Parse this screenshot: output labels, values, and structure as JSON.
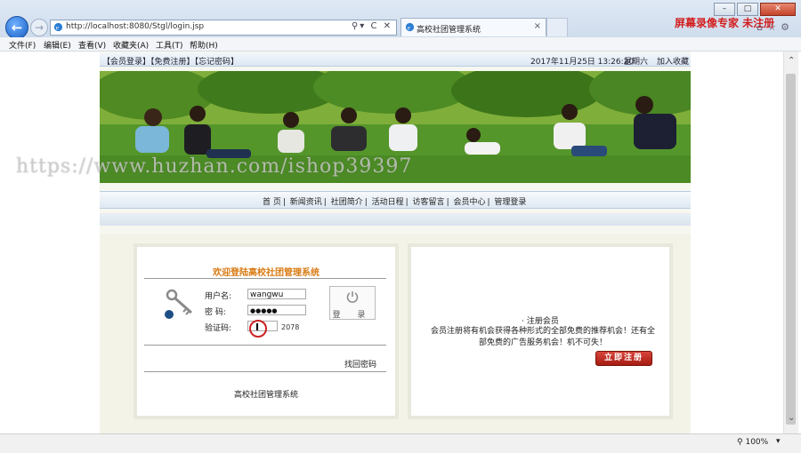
{
  "browser": {
    "url": "http://localhost:8080/Stgl/login.jsp",
    "tab_title": "高校社团管理系统",
    "recorder_text": "屏幕录像专家  未注册",
    "zoom": "100%",
    "menu": [
      "文件(F)",
      "编辑(E)",
      "查看(V)",
      "收藏夹(A)",
      "工具(T)",
      "帮助(H)"
    ]
  },
  "topbar": {
    "links": "【会员登录】【免费注册】【忘记密码】",
    "date": "2017年11月25日  13:26:20",
    "weekday": "星期六",
    "favorite": "加入收藏"
  },
  "nav": [
    "首  页",
    "新闻资讯",
    "社团简介",
    "活动日程",
    "访客留言",
    "会员中心",
    "管理登录"
  ],
  "login": {
    "welcome": "欢迎登陆高校社团管理系统",
    "username_label": "用户名:",
    "username_value": "wangwu",
    "password_label": "密  码:",
    "password_value": "●●●●●",
    "captcha_label": "验证码:",
    "captcha_value": "",
    "captcha_code": "2078",
    "login_button": "登  录",
    "forgot": "找回密码",
    "system_name": "高校社团管理系统"
  },
  "register": {
    "title": "· 注册会员",
    "description": "会员注册将有机会获得各种形式的全部免费的推荐机会！还有全部免费的广告服务机会！机不可失！",
    "button": "立即注册"
  },
  "watermark": "https://www.huzhan.com/ishop39397",
  "colors": {
    "accent": "#d87a12",
    "register_button": "#b8261a",
    "recorder_red": "#d21f1f"
  }
}
